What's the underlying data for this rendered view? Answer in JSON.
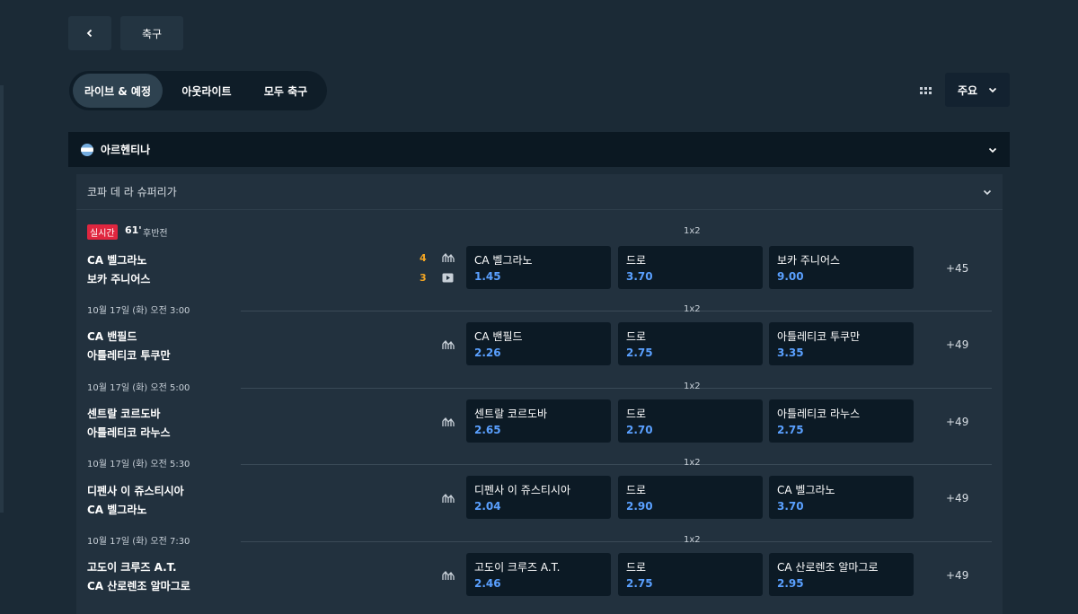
{
  "top": {
    "back_label": "‹",
    "title": "축구"
  },
  "tabs": [
    "라이브 & 예정",
    "아웃라이트",
    "모두 축구"
  ],
  "sort": {
    "value": "주요"
  },
  "country": {
    "name": "아르헨티나"
  },
  "league": {
    "name": "코파 데 라 슈퍼리가"
  },
  "market_label": "1x2",
  "live": {
    "badge": "실시간",
    "minute": "61'",
    "period": "후반전"
  },
  "matches": [
    {
      "date": "",
      "team1": "CA 벨그라노",
      "team2": "보카 주니어스",
      "score1": "4",
      "score2": "3",
      "odds": [
        {
          "label": "CA 벨그라노",
          "value": "1.45"
        },
        {
          "label": "드로",
          "value": "3.70"
        },
        {
          "label": "보카 주니어스",
          "value": "9.00"
        }
      ],
      "more": "+45"
    },
    {
      "date": "10월 17일 (화) 오전 3:00",
      "team1": "CA 밴필드",
      "team2": "아틀레티코 투쿠만",
      "odds": [
        {
          "label": "CA 밴필드",
          "value": "2.26"
        },
        {
          "label": "드로",
          "value": "2.75"
        },
        {
          "label": "아틀레티코 투쿠만",
          "value": "3.35"
        }
      ],
      "more": "+49"
    },
    {
      "date": "10월 17일 (화) 오전 5:00",
      "team1": "센트랄 코르도바",
      "team2": "아틀레티코 라누스",
      "odds": [
        {
          "label": "센트랄 코르도바",
          "value": "2.65"
        },
        {
          "label": "드로",
          "value": "2.70"
        },
        {
          "label": "아틀레티코 라누스",
          "value": "2.75"
        }
      ],
      "more": "+49"
    },
    {
      "date": "10월 17일 (화) 오전 5:30",
      "team1": "디펜사 이 쥬스티시아",
      "team2": "CA 벨그라노",
      "odds": [
        {
          "label": "디펜사 이 쥬스티시아",
          "value": "2.04"
        },
        {
          "label": "드로",
          "value": "2.90"
        },
        {
          "label": "CA 벨그라노",
          "value": "3.70"
        }
      ],
      "more": "+49"
    },
    {
      "date": "10월 17일 (화) 오전 7:30",
      "team1": "고도이 크루즈 A.T.",
      "team2": "CA 산로렌조 알마그로",
      "odds": [
        {
          "label": "고도이 크루즈 A.T.",
          "value": "2.46"
        },
        {
          "label": "드로",
          "value": "2.75"
        },
        {
          "label": "CA 산로렌조 알마그로",
          "value": "2.95"
        }
      ],
      "more": "+49"
    }
  ],
  "colors": {
    "accent_odds": "#5aa0ff",
    "live_red": "#e0263f",
    "score_orange": "#f4a623"
  }
}
